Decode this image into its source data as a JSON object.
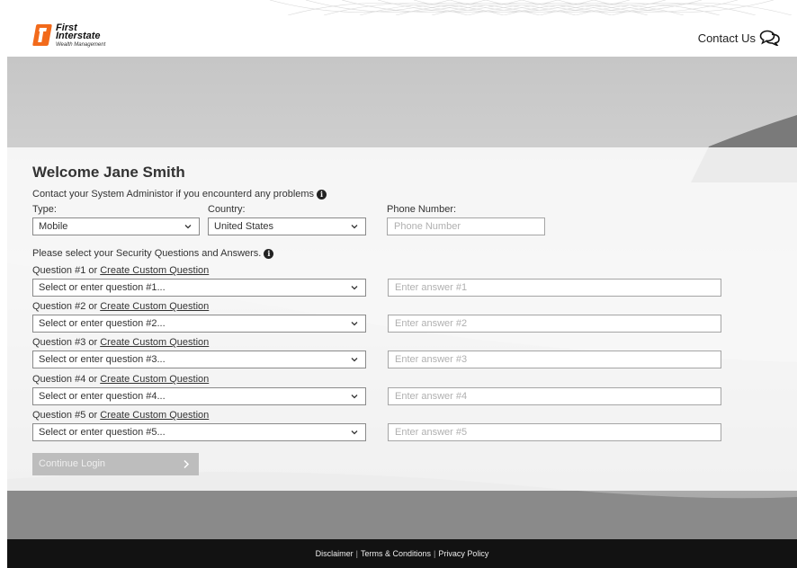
{
  "brand": {
    "name_line1": "First",
    "name_line2": "Interstate",
    "name_line3": "Wealth Management",
    "color": "#f26a1b"
  },
  "header": {
    "contact_label": "Contact Us",
    "contact_icon": "chat-bubbles-icon"
  },
  "form": {
    "welcome": "Welcome Jane Smith",
    "hint": "Contact your System Administor if you encounterd any problems",
    "type_label": "Type:",
    "type_value": "Mobile",
    "country_label": "Country:",
    "country_value": "United States",
    "phone_label": "Phone Number:",
    "phone_placeholder": "Phone Number",
    "security_hint": "Please select your Security Questions and Answers.",
    "custom_link": "Create Custom Question",
    "questions": [
      {
        "label": "Question #1 or",
        "placeholder": "Select or enter question #1...",
        "answer_placeholder": "Enter answer #1"
      },
      {
        "label": "Question #2 or",
        "placeholder": "Select or enter question #2...",
        "answer_placeholder": "Enter answer #2"
      },
      {
        "label": "Question #3 or",
        "placeholder": "Select or enter question #3...",
        "answer_placeholder": "Enter answer #3"
      },
      {
        "label": "Question #4 or",
        "placeholder": "Select or enter question #4...",
        "answer_placeholder": "Enter answer #4"
      },
      {
        "label": "Question #5 or",
        "placeholder": "Select or enter question #5...",
        "answer_placeholder": "Enter answer #5"
      }
    ],
    "continue_label": "Continue Login"
  },
  "footer": {
    "disclaimer": "Disclaimer",
    "terms": "Terms & Conditions",
    "privacy": "Privacy Policy",
    "separator": "|"
  }
}
